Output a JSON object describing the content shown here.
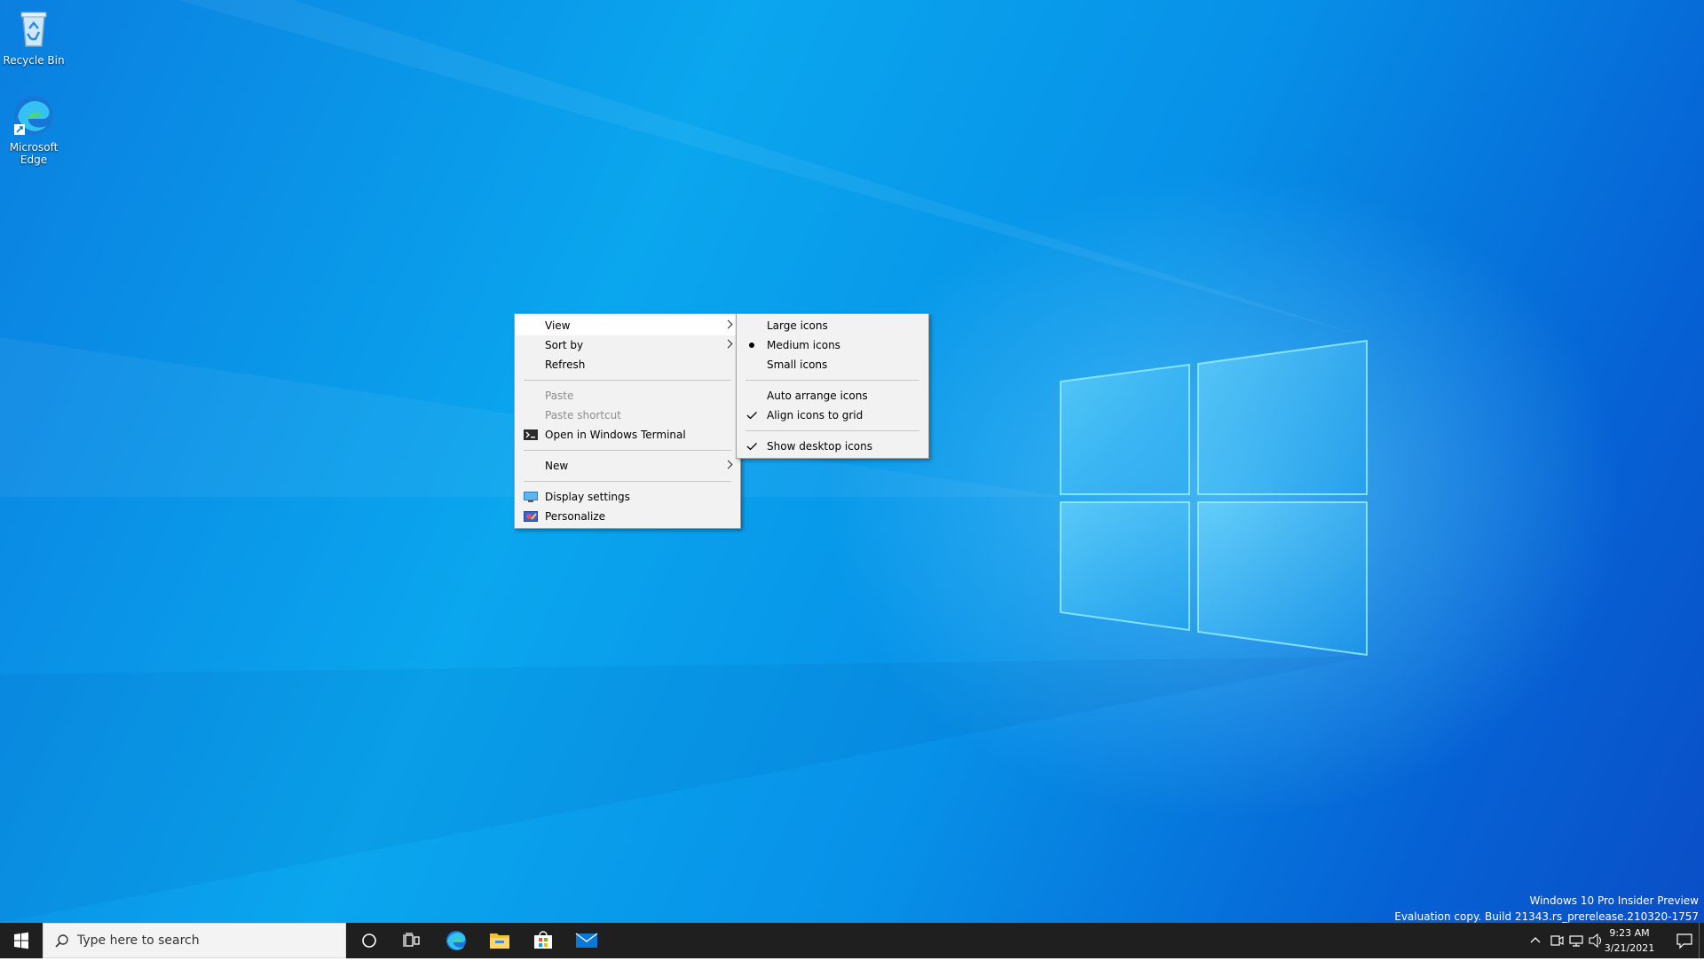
{
  "desktop": {
    "icons": [
      {
        "label": "Recycle Bin",
        "icon": "recycle-bin-icon"
      },
      {
        "label": "Microsoft Edge",
        "icon": "edge-icon"
      }
    ]
  },
  "context_menu": {
    "items": {
      "view": "View",
      "sort_by": "Sort by",
      "refresh": "Refresh",
      "paste": "Paste",
      "paste_shortcut": "Paste shortcut",
      "open_terminal": "Open in Windows Terminal",
      "new": "New",
      "display_settings": "Display settings",
      "personalize": "Personalize"
    }
  },
  "view_submenu": {
    "large_icons": "Large icons",
    "medium_icons": "Medium icons",
    "small_icons": "Small icons",
    "auto_arrange": "Auto arrange icons",
    "align_to_grid": "Align icons to grid",
    "show_desktop_icons": "Show desktop icons"
  },
  "watermark": {
    "line1": "Windows 10 Pro Insider Preview",
    "line2": "Evaluation copy. Build 21343.rs_prerelease.210320-1757"
  },
  "taskbar": {
    "search_placeholder": "Type here to search",
    "apps": [
      "cortana-icon",
      "task-view-icon",
      "edge-icon",
      "file-explorer-icon",
      "store-icon",
      "mail-icon"
    ]
  },
  "clock": {
    "time": "9:23 AM",
    "date": "3/21/2021"
  },
  "colors": {
    "taskbar": "#1f1f1f",
    "menu_bg": "#f2f2f2",
    "desktop_blue": "#0aa6ee"
  }
}
